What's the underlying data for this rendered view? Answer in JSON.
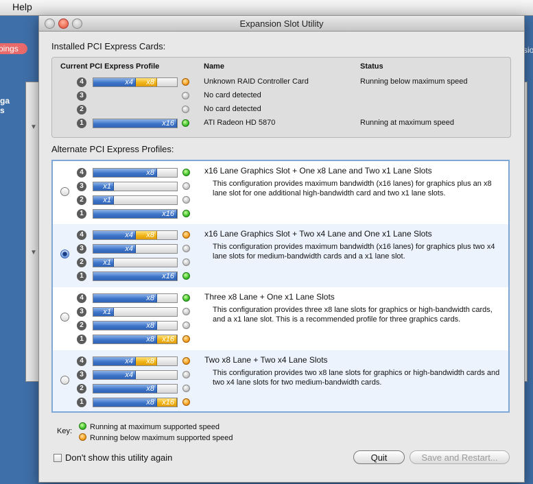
{
  "menubar": {
    "help": "Help"
  },
  "background": {
    "badge": "pings",
    "left_text": "ga\ns",
    "right_text": "sio"
  },
  "window": {
    "title": "Expansion Slot Utility"
  },
  "installed": {
    "section_label": "Installed PCI Express Cards:",
    "headers": {
      "profile": "Current PCI Express Profile",
      "name": "Name",
      "status": "Status"
    },
    "rows": [
      {
        "slot": "4",
        "name": "Unknown RAID Controller Card",
        "status": "Running below maximum speed"
      },
      {
        "slot": "3",
        "name": "No card detected",
        "status": ""
      },
      {
        "slot": "2",
        "name": "No card detected",
        "status": ""
      },
      {
        "slot": "1",
        "name": "ATI Radeon HD 5870",
        "status": "Running at maximum speed"
      }
    ]
  },
  "alternate": {
    "section_label": "Alternate PCI Express Profiles:",
    "profiles": [
      {
        "title": "x16 Lane Graphics Slot + One x8 Lane and Two x1 Lane Slots",
        "description": "This configuration provides maximum bandwidth (x16 lanes) for graphics plus an x8 lane slot for one additional high-bandwidth card and two x1 lane slots.",
        "selected": false
      },
      {
        "title": "x16 Lane Graphics Slot + Two x4 Lane and One x1 Lane Slots",
        "description": "This configuration provides maximum bandwidth (x16 lanes) for graphics plus two x4 lane slots for medium-bandwidth cards and a x1 lane slot.",
        "selected": true
      },
      {
        "title": "Three x8 Lane + One x1 Lane Slots",
        "description": "This configuration provides three x8 lane slots for graphics or high-bandwidth cards, and a x1 lane slot.  This is a recommended profile for three graphics cards.",
        "selected": false
      },
      {
        "title": "Two x8 Lane + Two x4 Lane Slots",
        "description": "This configuration provides two x8 lane slots for graphics or high-bandwidth cards and two x4 lane slots for two medium-bandwidth cards.",
        "selected": false
      }
    ]
  },
  "key": {
    "label": "Key:",
    "green": "Running at maximum supported speed",
    "orange": "Running below maximum supported speed"
  },
  "footer": {
    "dont_show": "Don't show this utility again",
    "quit": "Quit",
    "save_restart": "Save and Restart..."
  },
  "colors": {
    "lane_blue": "#3e74c8",
    "lane_orange": "#f0b41a",
    "led_green": "#3fc12a",
    "led_orange": "#f5a122"
  }
}
